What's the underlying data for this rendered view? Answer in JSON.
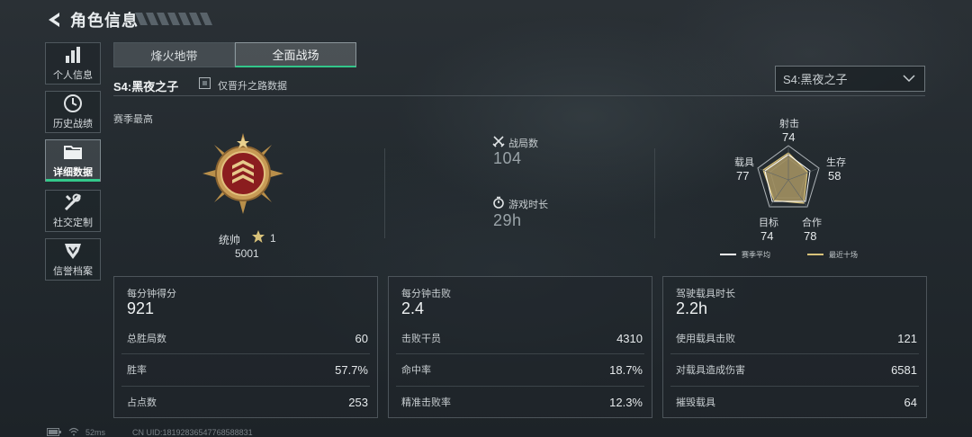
{
  "header": {
    "title": "角色信息"
  },
  "sidebar": {
    "items": [
      {
        "label": "个人信息",
        "icon": "bar-chart-icon",
        "active": false
      },
      {
        "label": "历史战绩",
        "icon": "clock-icon",
        "active": false
      },
      {
        "label": "详细数据",
        "icon": "folder-icon",
        "active": true
      },
      {
        "label": "社交定制",
        "icon": "tools-icon",
        "active": false
      },
      {
        "label": "信誉档案",
        "icon": "shield-emblem-icon",
        "active": false
      }
    ]
  },
  "tabs": [
    {
      "label": "烽火地带",
      "active": false
    },
    {
      "label": "全面战场",
      "active": true
    }
  ],
  "season": {
    "title": "S4:黑夜之子",
    "checkbox_label": "仅晋升之路数据",
    "dropdown_value": "S4:黑夜之子"
  },
  "best": {
    "label": "赛季最高",
    "rank_name": "统帅",
    "rank_stars": "1",
    "rank_points": "5001"
  },
  "summary": {
    "matches_label": "战局数",
    "matches_value": "104",
    "time_label": "游戏时长",
    "time_value": "29h"
  },
  "radar": {
    "axes": [
      {
        "label": "射击",
        "value": "74"
      },
      {
        "label": "生存",
        "value": "58"
      },
      {
        "label": "合作",
        "value": "78"
      },
      {
        "label": "目标",
        "value": "74"
      },
      {
        "label": "载具",
        "value": "77"
      }
    ],
    "legend": [
      {
        "label": "赛季平均",
        "color": "#ffffff"
      },
      {
        "label": "最近十场",
        "color": "#d8c27a"
      }
    ]
  },
  "cards": [
    {
      "title": "每分钟得分",
      "value": "921",
      "rows": [
        {
          "label": "总胜局数",
          "value": "60"
        },
        {
          "label": "胜率",
          "value": "57.7%"
        },
        {
          "label": "占点数",
          "value": "253"
        }
      ]
    },
    {
      "title": "每分钟击败",
      "value": "2.4",
      "rows": [
        {
          "label": "击败干员",
          "value": "4310"
        },
        {
          "label": "命中率",
          "value": "18.7%"
        },
        {
          "label": "精准击败率",
          "value": "12.3%"
        }
      ]
    },
    {
      "title": "驾驶载具时长",
      "value": "2.2h",
      "rows": [
        {
          "label": "使用载具击败",
          "value": "121"
        },
        {
          "label": "对载具造成伤害",
          "value": "6581"
        },
        {
          "label": "摧毁载具",
          "value": "64"
        }
      ]
    }
  ],
  "footer": {
    "ping": "52ms",
    "uid": "CN UID:18192836547768588831"
  },
  "colors": {
    "accent": "#33c98a",
    "radar_fill": "#d8c27a"
  }
}
